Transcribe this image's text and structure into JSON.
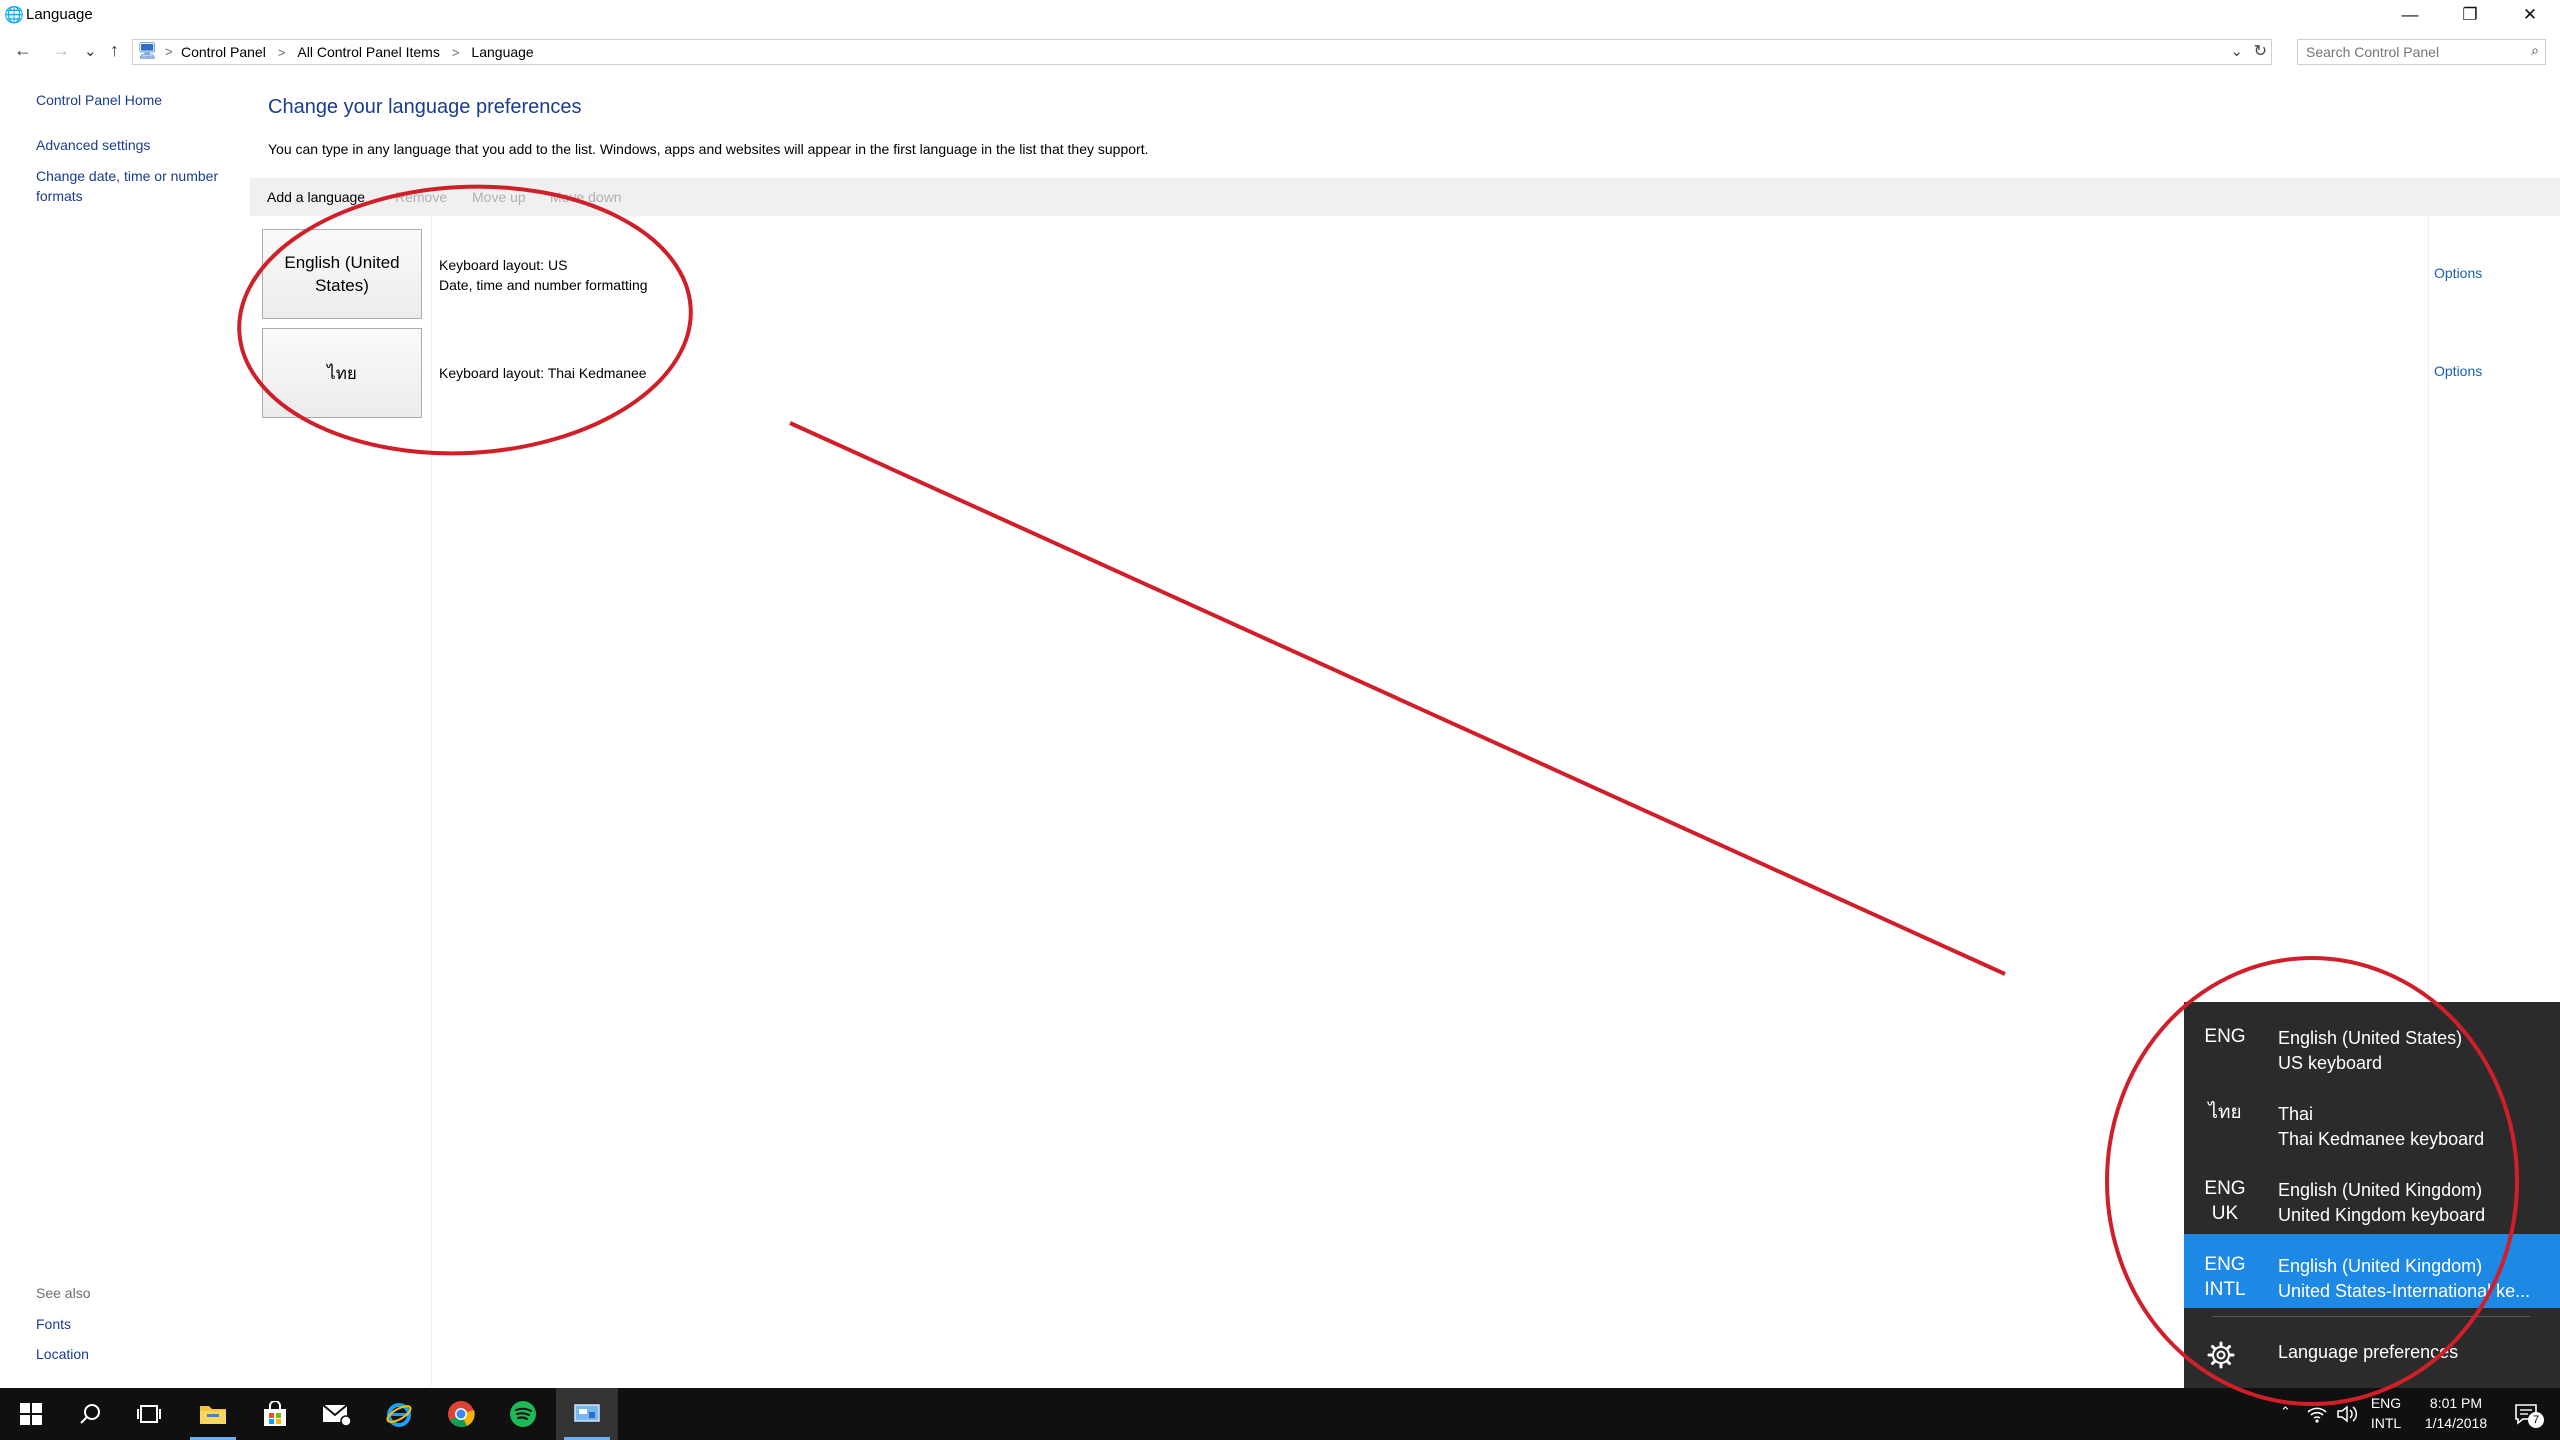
{
  "window": {
    "title": "Language",
    "minimize_glyph": "—",
    "restore_glyph": "❐",
    "close_glyph": "✕"
  },
  "address": {
    "back_glyph": "←",
    "forward_glyph": "→",
    "recent_glyph": "⌄",
    "up_glyph": "↑",
    "crumbs": [
      "Control Panel",
      "All Control Panel Items",
      "Language"
    ],
    "separator": ">",
    "dropdown_glyph": "⌄",
    "refresh_glyph": "↻",
    "search_placeholder": "Search Control Panel"
  },
  "sidebar": {
    "items": [
      {
        "label": "Control Panel Home"
      },
      {
        "label": "Advanced settings"
      },
      {
        "label": "Change date, time or number formats"
      }
    ],
    "see_also_title": "See also",
    "see_also": [
      {
        "label": "Fonts"
      },
      {
        "label": "Location"
      }
    ]
  },
  "main": {
    "heading": "Change your language preferences",
    "description": "You can type in any language that you add to the list. Windows, apps and websites will appear in the first language in the list that they support.",
    "toolbar": {
      "add": "Add a language",
      "remove": "Remove",
      "move_up": "Move up",
      "move_down": "Move down"
    },
    "languages": [
      {
        "name": "English (United States)",
        "line1": "Keyboard layout: US",
        "line2": "Date, time and number formatting",
        "options": "Options"
      },
      {
        "name": "ไทย",
        "line1": "Keyboard layout: Thai Kedmanee",
        "line2": "",
        "options": "Options"
      }
    ]
  },
  "flyout": {
    "items": [
      {
        "code1": "ENG",
        "code2": "",
        "name": "English (United States)",
        "keyboard": "US keyboard",
        "selected": false
      },
      {
        "code1": "ไทย",
        "code2": "",
        "name": "Thai",
        "keyboard": "Thai Kedmanee keyboard",
        "selected": false
      },
      {
        "code1": "ENG",
        "code2": "UK",
        "name": "English (United Kingdom)",
        "keyboard": "United Kingdom keyboard",
        "selected": false
      },
      {
        "code1": "ENG",
        "code2": "INTL",
        "name": "English (United Kingdom)",
        "keyboard": "United States-International ke...",
        "selected": true
      }
    ],
    "preferences": "Language preferences"
  },
  "taskbar": {
    "tray": {
      "input_code1": "ENG",
      "input_code2": "INTL",
      "time": "8:01 PM",
      "date": "1/14/2018",
      "notification_count": "7"
    }
  },
  "colors": {
    "link": "#1a3c8f",
    "flyout_bg": "#2b2b2b",
    "flyout_selected": "#1e88e5",
    "annotation": "#d11f2a"
  }
}
